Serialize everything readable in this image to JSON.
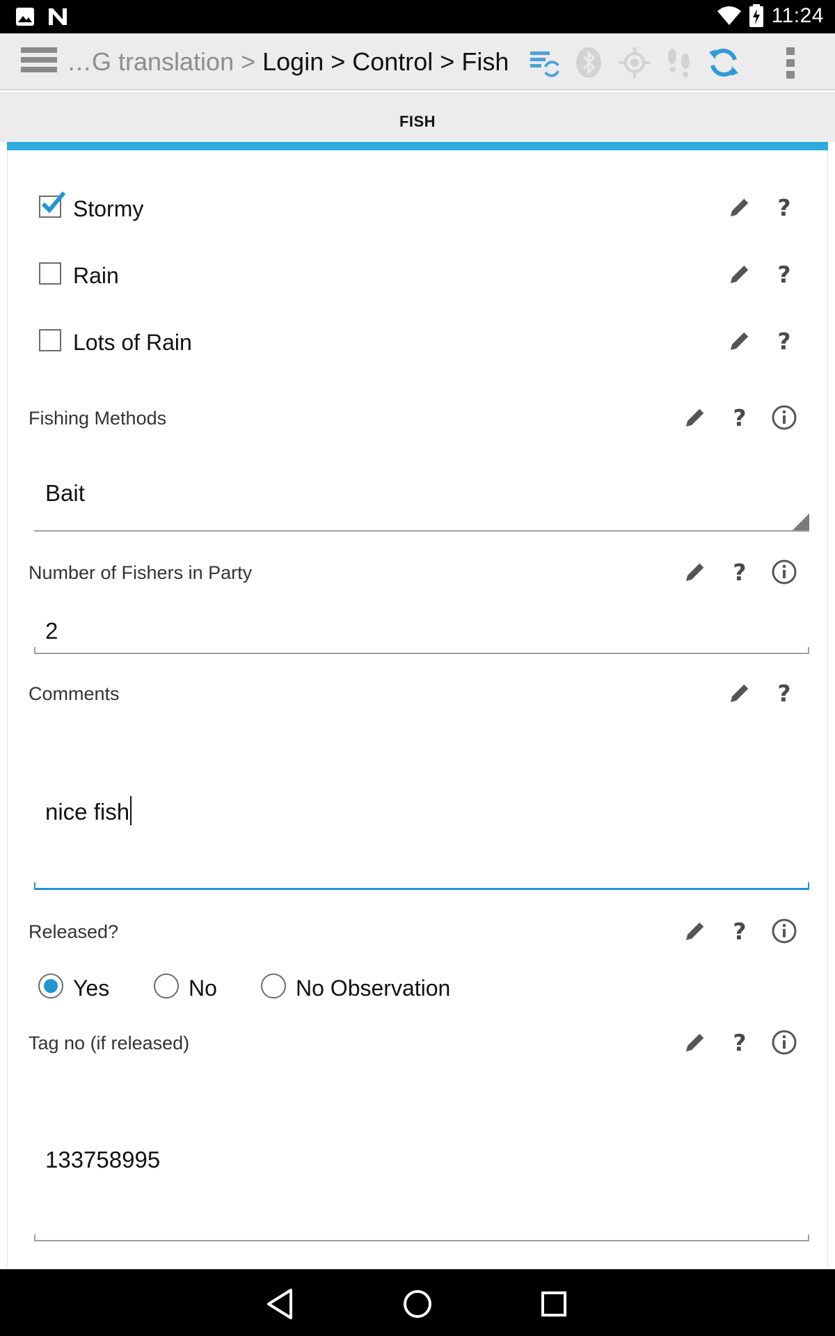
{
  "status_bar": {
    "time": "11:24",
    "left_icons": [
      "image-icon",
      "n-icon"
    ],
    "right_icons": [
      "wifi-icon",
      "battery-charging-icon"
    ]
  },
  "action_bar": {
    "breadcrumb_faded": "…G translation > ",
    "breadcrumb_main": "Login > Control > Fish",
    "icons": [
      "menu-icon",
      "sync-forms-icon",
      "bluetooth-icon",
      "gps-icon",
      "footsteps-icon",
      "refresh-icon",
      "overflow-menu-icon"
    ],
    "accent_color": "#2eaadc"
  },
  "tab": {
    "title": "FISH"
  },
  "weather_options": [
    {
      "label": "Stormy",
      "checked": true
    },
    {
      "label": "Rain",
      "checked": false
    },
    {
      "label": "Lots of Rain",
      "checked": false
    }
  ],
  "fields": {
    "fishing_methods": {
      "label": "Fishing Methods",
      "value": "Bait"
    },
    "fishers": {
      "label": "Number of Fishers in Party",
      "value": "2"
    },
    "comments": {
      "label": "Comments",
      "value": "nice fish"
    },
    "released": {
      "label": "Released?",
      "options": [
        "Yes",
        "No",
        "No Observation"
      ],
      "selected": "Yes"
    },
    "tag": {
      "label": "Tag no (if released)",
      "value": "133758995"
    }
  },
  "help_glyph": "?",
  "nav_bar": {
    "buttons": [
      "back-icon",
      "home-icon",
      "recents-icon"
    ]
  }
}
